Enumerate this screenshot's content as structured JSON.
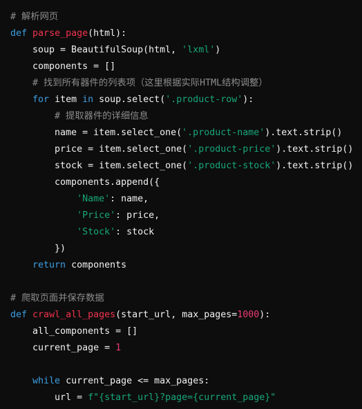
{
  "colors": {
    "background": "#0d0d0d",
    "keyword": "#3d9ee0",
    "function": "#f2334e",
    "string": "#17a77a",
    "number": "#ec3b72",
    "comment": "#8c8c8c",
    "text": "#f2f2f2"
  },
  "code_lines": [
    [
      [
        "cm",
        "# 解析网页"
      ]
    ],
    [
      [
        "kw",
        "def"
      ],
      [
        "tx",
        " "
      ],
      [
        "fn",
        "parse_page"
      ],
      [
        "tx",
        "(html):"
      ]
    ],
    [
      [
        "tx",
        "    soup = BeautifulSoup(html, "
      ],
      [
        "str",
        "'lxml'"
      ],
      [
        "tx",
        ")"
      ]
    ],
    [
      [
        "tx",
        "    components = []"
      ]
    ],
    [
      [
        "tx",
        "    "
      ],
      [
        "cm",
        "# 找到所有器件的列表项（这里根据实际HTML结构调整）"
      ]
    ],
    [
      [
        "tx",
        "    "
      ],
      [
        "kw",
        "for"
      ],
      [
        "tx",
        " item "
      ],
      [
        "kw",
        "in"
      ],
      [
        "tx",
        " soup.select("
      ],
      [
        "str",
        "'.product-row'"
      ],
      [
        "tx",
        "):"
      ]
    ],
    [
      [
        "tx",
        "        "
      ],
      [
        "cm",
        "# 提取器件的详细信息"
      ]
    ],
    [
      [
        "tx",
        "        name = item.select_one("
      ],
      [
        "str",
        "'.product-name'"
      ],
      [
        "tx",
        ").text.strip()"
      ]
    ],
    [
      [
        "tx",
        "        price = item.select_one("
      ],
      [
        "str",
        "'.product-price'"
      ],
      [
        "tx",
        ").text.strip()"
      ]
    ],
    [
      [
        "tx",
        "        stock = item.select_one("
      ],
      [
        "str",
        "'.product-stock'"
      ],
      [
        "tx",
        ").text.strip()"
      ]
    ],
    [
      [
        "tx",
        "        components.append({"
      ]
    ],
    [
      [
        "tx",
        "            "
      ],
      [
        "str",
        "'Name'"
      ],
      [
        "tx",
        ": name,"
      ]
    ],
    [
      [
        "tx",
        "            "
      ],
      [
        "str",
        "'Price'"
      ],
      [
        "tx",
        ": price,"
      ]
    ],
    [
      [
        "tx",
        "            "
      ],
      [
        "str",
        "'Stock'"
      ],
      [
        "tx",
        ": stock"
      ]
    ],
    [
      [
        "tx",
        "        })"
      ]
    ],
    [
      [
        "tx",
        "    "
      ],
      [
        "kw",
        "return"
      ],
      [
        "tx",
        " components"
      ]
    ],
    [],
    [
      [
        "cm",
        "# 爬取页面并保存数据"
      ]
    ],
    [
      [
        "kw",
        "def"
      ],
      [
        "tx",
        " "
      ],
      [
        "fn",
        "crawl_all_pages"
      ],
      [
        "tx",
        "(start_url, max_pages="
      ],
      [
        "num",
        "1000"
      ],
      [
        "tx",
        "):"
      ]
    ],
    [
      [
        "tx",
        "    all_components = []"
      ]
    ],
    [
      [
        "tx",
        "    current_page = "
      ],
      [
        "num",
        "1"
      ]
    ],
    [],
    [
      [
        "tx",
        "    "
      ],
      [
        "kw",
        "while"
      ],
      [
        "tx",
        " current_page <= max_pages:"
      ]
    ],
    [
      [
        "tx",
        "        url = "
      ],
      [
        "str",
        "f\"{start_url}?page={current_page}\""
      ]
    ]
  ]
}
